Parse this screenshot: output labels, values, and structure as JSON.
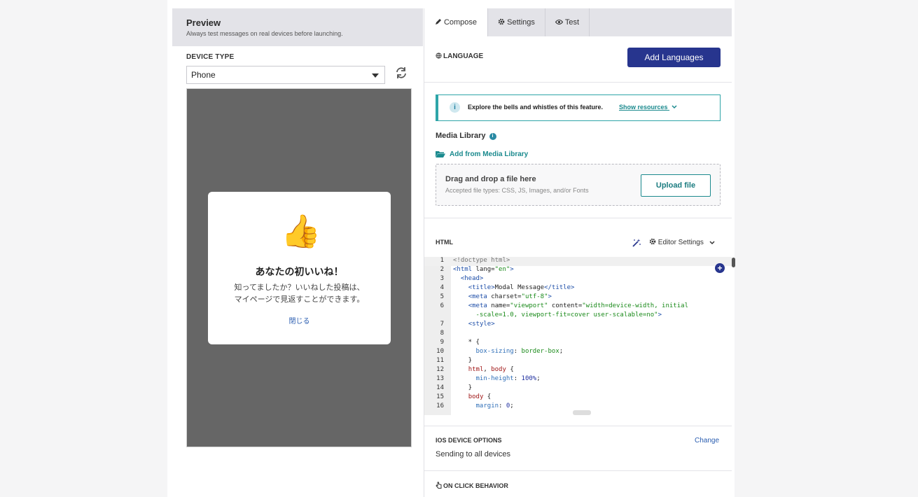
{
  "preview": {
    "title": "Preview",
    "subtitle": "Always test messages on real devices before launching.",
    "device_type_label": "DEVICE TYPE",
    "device_selected": "Phone",
    "modal": {
      "emoji": "👍",
      "title": "あなたの初いいね！",
      "body_line1": "知ってましたか？いいねした投稿は、",
      "body_line2": "マイページで見返すことができます。",
      "close": "閉じる"
    }
  },
  "tabs": [
    {
      "label": "Compose",
      "icon": "pencil-icon"
    },
    {
      "label": "Settings",
      "icon": "gear-icon"
    },
    {
      "label": "Test",
      "icon": "eye-icon"
    }
  ],
  "language": {
    "label": "LANGUAGE",
    "add_button": "Add Languages"
  },
  "info": {
    "text": "Explore the bells and whistles of this feature.",
    "link": "Show resources"
  },
  "media": {
    "title": "Media Library",
    "add_link": "Add from Media Library",
    "drop_title": "Drag and drop a file here",
    "drop_sub": "Accepted file types: CSS, JS, Images, and/or Fonts",
    "upload_button": "Upload file"
  },
  "html_editor": {
    "label": "HTML",
    "settings_label": "Editor Settings",
    "line_numbers": [
      "1",
      "2",
      "3",
      "4",
      "5",
      "6",
      "",
      "7",
      "8",
      "9",
      "10",
      "11",
      "12",
      "13",
      "14",
      "15",
      "16"
    ]
  },
  "ios": {
    "label": "IOS DEVICE OPTIONS",
    "change": "Change",
    "value": "Sending to all devices"
  },
  "on_click": {
    "label": "ON CLICK BEHAVIOR"
  },
  "colors": {
    "primary": "#27358e",
    "teal": "#1b8a8e",
    "phone_bg": "#666666"
  }
}
